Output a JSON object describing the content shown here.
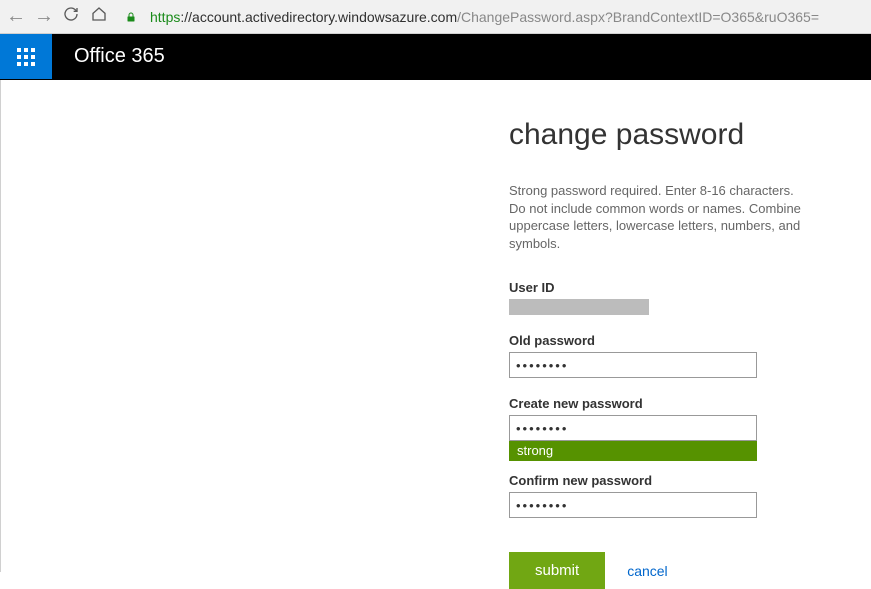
{
  "browser": {
    "url_scheme": "https",
    "url_host": "://account.activedirectory.windowsazure.com",
    "url_path": "/ChangePassword.aspx?BrandContextID=O365&ruO365="
  },
  "header": {
    "brand": "Office 365"
  },
  "page": {
    "title": "change password",
    "description": "Strong password required. Enter 8-16 characters. Do not include common words or names. Combine uppercase letters, lowercase letters, numbers, and symbols."
  },
  "form": {
    "user_id_label": "User ID",
    "old_pw_label": "Old password",
    "old_pw_value": "••••••••",
    "new_pw_label": "Create new password",
    "new_pw_value": "••••••••",
    "strength_text": "strong",
    "confirm_pw_label": "Confirm new password",
    "confirm_pw_value": "••••••••",
    "submit_label": "submit",
    "cancel_label": "cancel"
  }
}
